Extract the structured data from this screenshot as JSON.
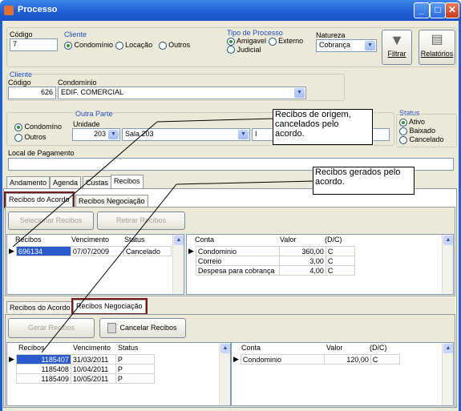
{
  "window": {
    "title": "Processo"
  },
  "codigo": {
    "label": "Código",
    "value": "7"
  },
  "cliente_radio": {
    "label": "Cliente",
    "options": [
      "Condomínio",
      "Locação",
      "Outros"
    ],
    "selected": "Condomínio"
  },
  "tipo": {
    "label": "Tipo de Processo",
    "options": [
      "Amigavel",
      "Externo",
      "Judicial"
    ],
    "selected": "Amigavel"
  },
  "natureza": {
    "label": "Natureza",
    "value": "Cobrança"
  },
  "toolbar": {
    "filtrar": "Filtrar",
    "relatorios": "Relatórios"
  },
  "cliente": {
    "group": "Cliente",
    "codigo_label": "Código",
    "codigo": "626",
    "condominio_label": "Condomínio",
    "condominio": "EDIF. COMERCIAL"
  },
  "outra": {
    "group": "Outra Parte",
    "unidade_label": "Unidade",
    "unidade": "203",
    "sala": "Sala 203",
    "field": "I",
    "options": [
      "Condomíno",
      "Outros"
    ],
    "selected": "Condomíno"
  },
  "status": {
    "label": "Status",
    "options": [
      "Ativo",
      "Baixado",
      "Cancelado"
    ],
    "selected": "Ativo"
  },
  "local": {
    "label": "Local de Pagamento",
    "value": ""
  },
  "tabs": [
    "Andamento",
    "Agenda",
    "Custas",
    "Recibos"
  ],
  "subtabs": [
    "Recibos do Acordo",
    "Recibos Negociação"
  ],
  "acordo": {
    "buttons": {
      "selecionar": "Selecionar Recibos",
      "retirar": "Retirar Recibos"
    },
    "headers": [
      "Recibos",
      "Vencimento",
      "Status"
    ],
    "rows": [
      [
        "696134",
        "07/07/2009",
        "Cancelado"
      ]
    ],
    "detail_headers": [
      "Conta",
      "Valor",
      "(D/C)"
    ],
    "detail_rows": [
      [
        "Condominio",
        "360,00",
        "C"
      ],
      [
        "Correio",
        "3,00",
        "C"
      ],
      [
        "Despesa para cobrança",
        "4,00",
        "C"
      ]
    ]
  },
  "negociacao": {
    "buttons": {
      "gerar": "Gerar Recibos",
      "cancelar": "Cancelar Recibos"
    },
    "headers": [
      "Recibos",
      "Vencimento",
      "Status"
    ],
    "rows": [
      [
        "1185407",
        "31/03/2011",
        "P"
      ],
      [
        "1185408",
        "10/04/2011",
        "P"
      ],
      [
        "1185409",
        "10/05/2011",
        "P"
      ]
    ],
    "detail_headers": [
      "Conta",
      "Valor",
      "(D/C)"
    ],
    "detail_rows": [
      [
        "Condominio",
        "120,00",
        "C"
      ]
    ]
  },
  "callouts": {
    "origem": "Recibos de origem, cancelados pelo acordo.",
    "gerados": "Recibos gerados pelo acordo."
  },
  "colors": {
    "titlebar": "#1f5fd6",
    "highlight": "#7a1a1a",
    "group_label": "#1c4fc4"
  }
}
